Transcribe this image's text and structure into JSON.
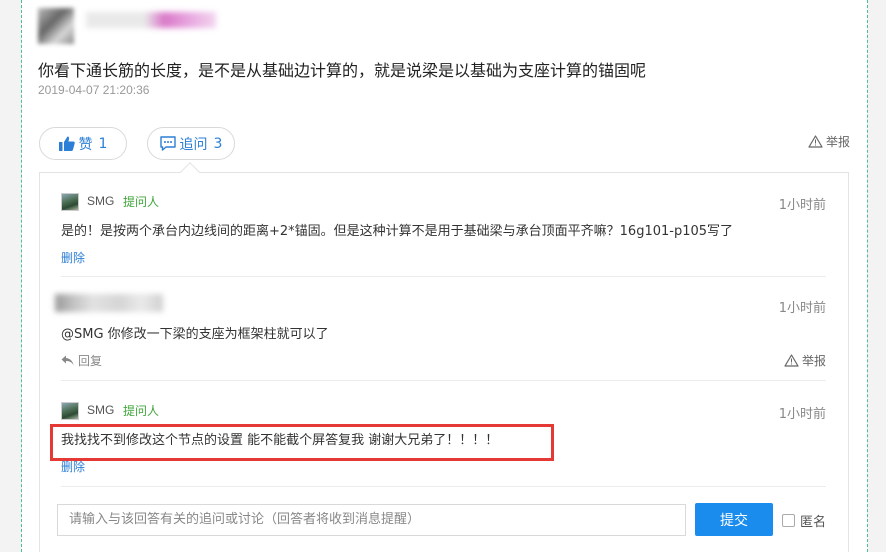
{
  "question": {
    "text": "你看下通长筋的长度，是不是从基础边计算的，就是说梁是以基础为支座计算的锚固呢",
    "time": "2019-04-07 21:20:36"
  },
  "actions": {
    "like_label": "赞",
    "like_count": "1",
    "ask_label": "追问",
    "ask_count": "3",
    "report_label": "举报"
  },
  "replies": [
    {
      "name": "SMG",
      "role": "提问人",
      "time": "1小时前",
      "text": "是的！是按两个承台内边线间的距离+2*锚固。但是这种计算不是用于基础梁与承台顶面平齐嘛？16g101-p105写了",
      "action": "删除"
    },
    {
      "name": "",
      "time": "1小时前",
      "text": "@SMG 你修改一下梁的支座为框架柱就可以了",
      "action": "回复",
      "report": "举报"
    },
    {
      "name": "SMG",
      "role": "提问人",
      "time": "1小时前",
      "text": "我找找不到修改这个节点的设置 能不能截个屏答复我 谢谢大兄弟了！！！！",
      "action": "删除"
    }
  ],
  "comment": {
    "placeholder": "请输入与该回答有关的追问或讨论（回答者将收到消息提醒）",
    "submit_label": "提交",
    "anonymous_label": "匿名"
  },
  "colors": {
    "accent": "#1a8cee",
    "link": "#2b7fd6",
    "role_green": "#3fa639",
    "highlight_red": "#e53935"
  }
}
